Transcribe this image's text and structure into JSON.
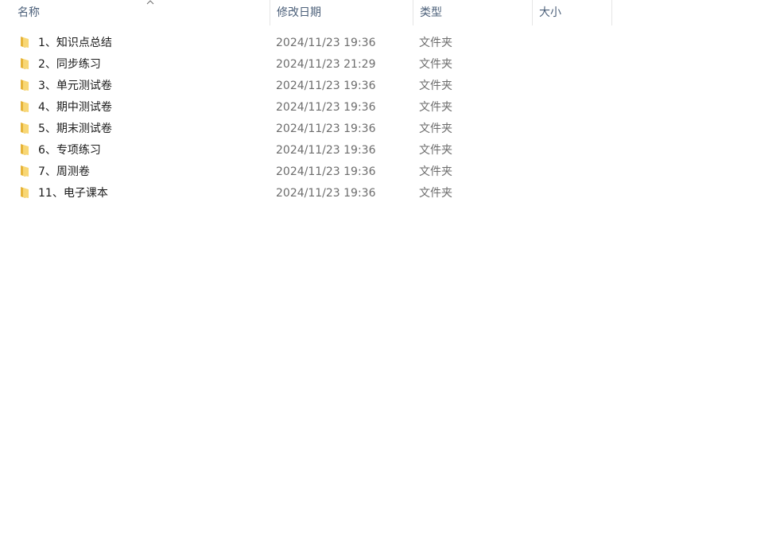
{
  "header": {
    "name_label": "名称",
    "date_label": "修改日期",
    "type_label": "类型",
    "size_label": "大小",
    "sort_indicator": "sort-ascending-caret-icon"
  },
  "files": [
    {
      "name": "1、知识点总结",
      "date": "2024/11/23 19:36",
      "type": "文件夹",
      "icon": "folder-icon"
    },
    {
      "name": "2、同步练习",
      "date": "2024/11/23 21:29",
      "type": "文件夹",
      "icon": "folder-icon"
    },
    {
      "name": "3、单元测试卷",
      "date": "2024/11/23 19:36",
      "type": "文件夹",
      "icon": "folder-icon"
    },
    {
      "name": "4、期中测试卷",
      "date": "2024/11/23 19:36",
      "type": "文件夹",
      "icon": "folder-icon"
    },
    {
      "name": "5、期末测试卷",
      "date": "2024/11/23 19:36",
      "type": "文件夹",
      "icon": "folder-icon"
    },
    {
      "name": "6、专项练习",
      "date": "2024/11/23 19:36",
      "type": "文件夹",
      "icon": "folder-icon"
    },
    {
      "name": "7、周测卷",
      "date": "2024/11/23 19:36",
      "type": "文件夹",
      "icon": "folder-icon"
    },
    {
      "name": "11、电子课本",
      "date": "2024/11/23 19:36",
      "type": "文件夹",
      "icon": "folder-icon"
    }
  ],
  "colors": {
    "folder_yellow": "#f8d775",
    "folder_dark": "#e6b43a",
    "header_text": "#4c607a",
    "secondary_text": "#6d6d6d"
  }
}
